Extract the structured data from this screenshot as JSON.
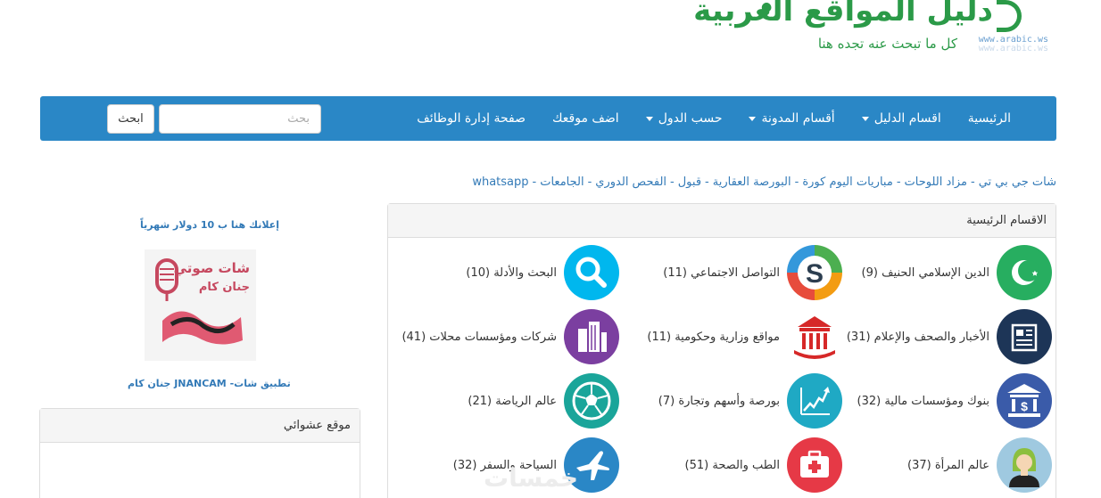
{
  "logo": {
    "title": "دليل المواقع العربية",
    "tagline": "كل ما تبحث عنه تجده هنا",
    "url": "www.arabic.ws",
    "url_ghost": "www.arabic.ws"
  },
  "nav": {
    "items": [
      {
        "label": "الرئيسية",
        "dropdown": false
      },
      {
        "label": "اقسام الدليل",
        "dropdown": true
      },
      {
        "label": "أقسام المدونة",
        "dropdown": true
      },
      {
        "label": "حسب الدول",
        "dropdown": true
      },
      {
        "label": "اضف موقعك",
        "dropdown": false
      },
      {
        "label": "صفحة إدارة الوظائف",
        "dropdown": false
      }
    ],
    "search_placeholder": "بحث",
    "search_button": "ابحث"
  },
  "links": [
    "شات جي بي تي",
    "مزاد اللوحات",
    "مباريات اليوم كورة",
    "البورصة العقارية",
    "قبول",
    "الفحص الدوري",
    "الجامعات",
    "whatsapp"
  ],
  "links_separator": "-",
  "main_panel": {
    "title": "الاقسام الرئيسية",
    "categories": [
      {
        "label": "الدين الإسلامي الحنيف (9)",
        "icon": "crescent-icon",
        "color": "#27ae60"
      },
      {
        "label": "التواصل الاجتماعي (11)",
        "icon": "social-s-icon",
        "color": "#ffffff"
      },
      {
        "label": "البحث والأدلة (10)",
        "icon": "search-icon",
        "color": "#00b7ee"
      },
      {
        "label": "الأخبار والصحف والإعلام (31)",
        "icon": "newspaper-icon",
        "color": "#1d3557"
      },
      {
        "label": "مواقع وزارية وحكومية (11)",
        "icon": "government-building-icon",
        "color": "#ffffff"
      },
      {
        "label": "شركات ومؤسسات محلات (41)",
        "icon": "buildings-icon",
        "color": "#7b3fa0"
      },
      {
        "label": "بنوك ومؤسسات مالية (32)",
        "icon": "bank-icon",
        "color": "#3a5ba9"
      },
      {
        "label": "بورصة وأسهم وتجارة (7)",
        "icon": "stock-chart-icon",
        "color": "#1fa9c4"
      },
      {
        "label": "عالم الرياضة (21)",
        "icon": "football-icon",
        "color": "#1aa59a"
      },
      {
        "label": "عالم المرأة (37)",
        "icon": "woman-icon",
        "color": "#9fc9e0"
      },
      {
        "label": "الطب والصحة (51)",
        "icon": "medical-kit-icon",
        "color": "#e63946"
      },
      {
        "label": "السياحة والسفر (32)",
        "icon": "airplane-icon",
        "color": "#2a87c6"
      }
    ]
  },
  "sidebar": {
    "ad_title": "إعلانك هنا ب 10 دولار شهرياً",
    "ad_image_text": "شات صوتي",
    "ad_image_text2": "جنان كام",
    "ad_caption": "تطبيق شات- JNANCAM جنان كام",
    "random_site_title": "موقع عشوائي"
  },
  "watermark": "خمسات"
}
